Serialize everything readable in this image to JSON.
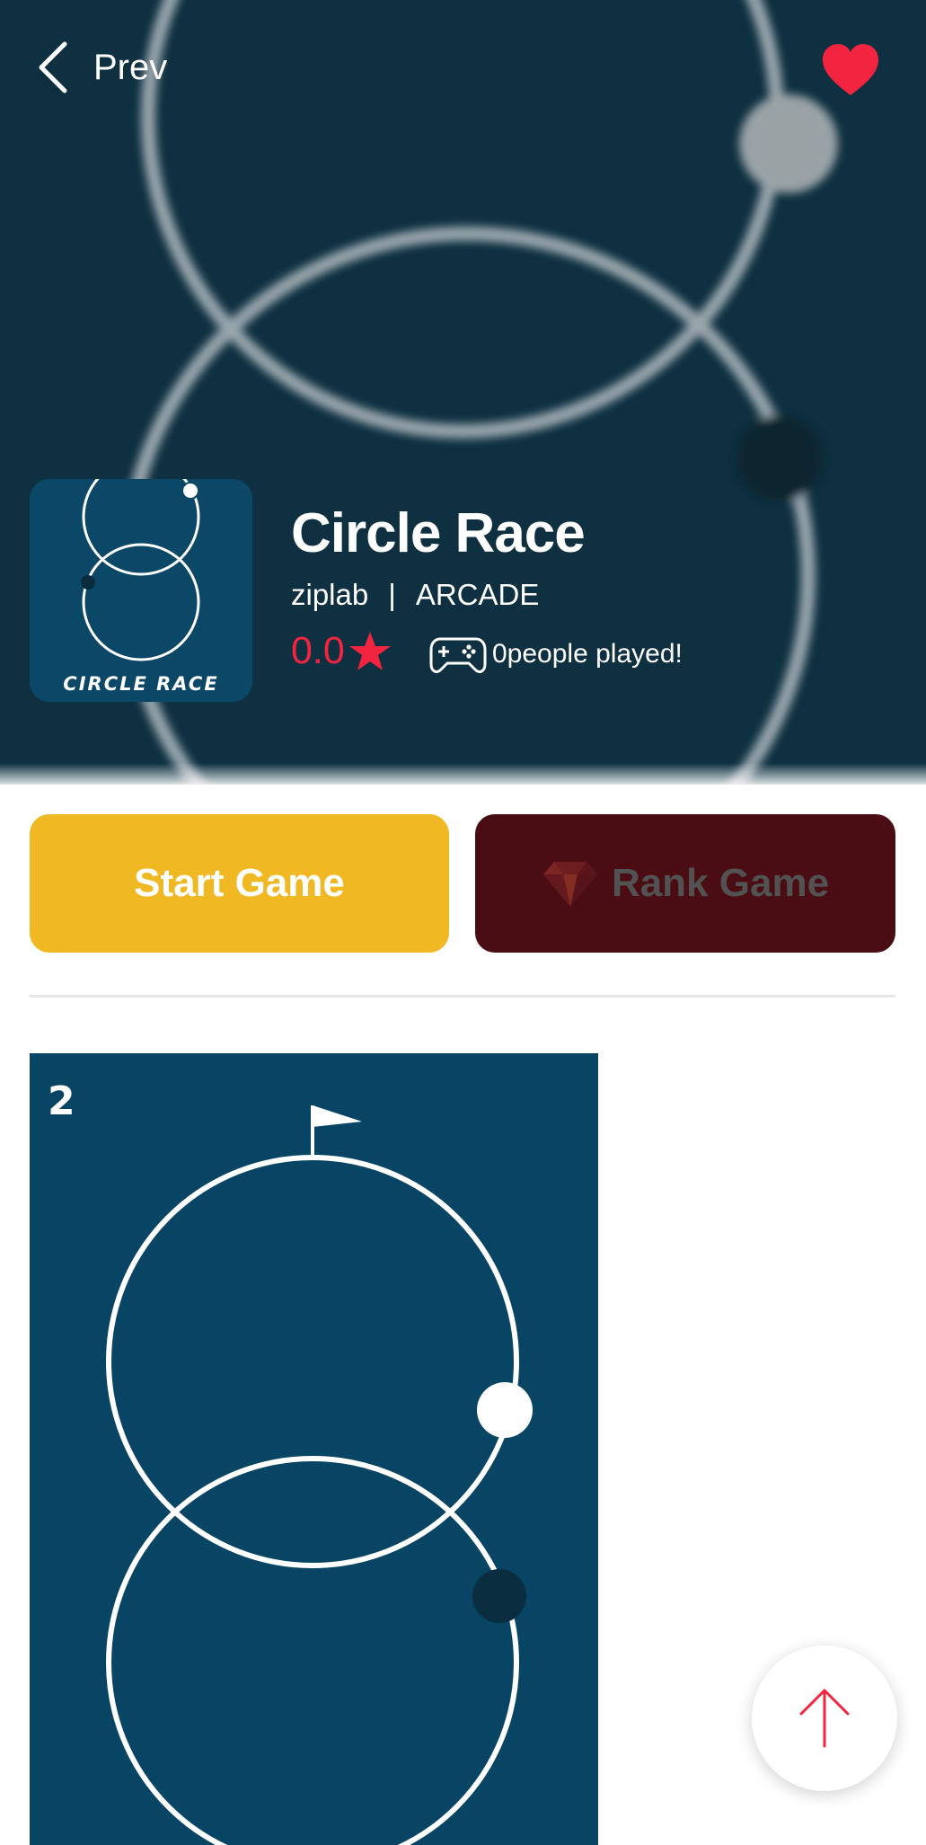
{
  "header": {
    "back_label": "Prev",
    "favorite_color": "#f2243f"
  },
  "game": {
    "title": "Circle Race",
    "developer": "ziplab",
    "separator": "|",
    "category": "ARCADE",
    "rating": "0.0",
    "played_text": "0people played!",
    "icon_label": "CIRCLE RACE"
  },
  "actions": {
    "start_label": "Start Game",
    "rank_label": "Rank Game"
  },
  "screenshots": [
    {
      "number": "2"
    }
  ],
  "colors": {
    "accent": "#f2243f",
    "start_button": "#f0b823",
    "rank_button": "#4b0d14",
    "hero_background": "#0e3040",
    "game_background": "#084564"
  },
  "icons": [
    "chevron-left-icon",
    "heart-icon",
    "star-icon",
    "gamepad-icon",
    "gem-icon",
    "arrow-up-icon",
    "flag-icon"
  ]
}
